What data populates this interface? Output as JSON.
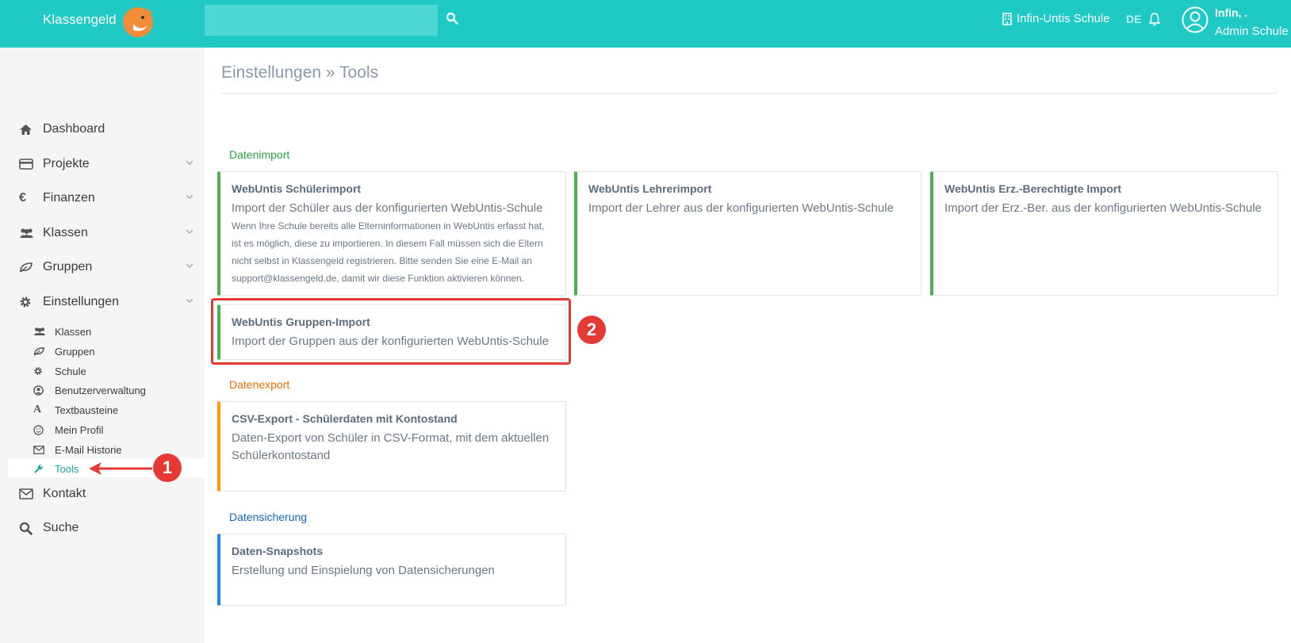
{
  "header": {
    "logo_text": "Klassengeld",
    "search_placeholder": "",
    "school_name": "Infin-Untis Schule",
    "language": "DE",
    "user_name": "Infin, .",
    "user_role": "Admin Schule"
  },
  "sidebar": {
    "items": [
      {
        "label": "Dashboard",
        "icon": "home-icon"
      },
      {
        "label": "Projekte",
        "icon": "card-icon"
      },
      {
        "label": "Finanzen",
        "icon": "euro-icon"
      },
      {
        "label": "Klassen",
        "icon": "users-icon"
      },
      {
        "label": "Gruppen",
        "icon": "leaf-icon"
      },
      {
        "label": "Einstellungen",
        "icon": "gear-icon"
      }
    ],
    "sub_items": [
      {
        "label": "Klassen",
        "icon": "users-icon"
      },
      {
        "label": "Gruppen",
        "icon": "leaf-icon"
      },
      {
        "label": "Schule",
        "icon": "gear-icon"
      },
      {
        "label": "Benutzerverwaltung",
        "icon": "user-circle-icon"
      },
      {
        "label": "Textbausteine",
        "icon": "font-icon"
      },
      {
        "label": "Mein Profil",
        "icon": "smile-icon"
      },
      {
        "label": "E-Mail Historie",
        "icon": "envelope-icon"
      },
      {
        "label": "Tools",
        "icon": "wrench-icon",
        "active": true
      }
    ],
    "bottom_items": [
      {
        "label": "Kontakt",
        "icon": "envelope-icon"
      },
      {
        "label": "Suche",
        "icon": "search-icon"
      }
    ]
  },
  "main": {
    "breadcrumb": "Einstellungen » Tools",
    "sections": {
      "import": {
        "title": "Datenimport",
        "color": "#2e9e3e",
        "cards": [
          {
            "title": "WebUntis Schülerimport",
            "desc": "Import der Schüler aus der konfigurierten WebUntis-Schule",
            "note": "Wenn Ihre Schule bereits alle Elterninformationen in WebUntis erfasst hat, ist es möglich, diese zu importieren. In diesem Fall müssen sich die Eltern nicht selbst in Klassengeld registrieren. Bitte senden Sie eine E-Mail an support@klassengeld.de, damit wir diese Funktion aktivieren können."
          },
          {
            "title": "WebUntis Lehrerimport",
            "desc": "Import der Lehrer aus der konfigurierten WebUntis-Schule"
          },
          {
            "title": "WebUntis Erz.-Berechtigte Import",
            "desc": "Import der Erz.-Ber. aus der konfigurierten WebUntis-Schule"
          },
          {
            "title": "WebUntis Gruppen-Import",
            "desc": "Import der Gruppen aus der konfigurierten WebUntis-Schule"
          }
        ]
      },
      "export": {
        "title": "Datenexport",
        "color": "#ef6c00",
        "cards": [
          {
            "title": "CSV-Export - Schülerdaten mit Kontostand",
            "desc": "Daten-Export von Schüler in CSV-Format, mit dem aktuellen Schülerkontostand"
          }
        ]
      },
      "backup": {
        "title": "Datensicherung",
        "color": "#1565c0",
        "cards": [
          {
            "title": "Daten-Snapshots",
            "desc": "Erstellung und Einspielung von Datensicherungen"
          }
        ]
      }
    }
  },
  "annotations": {
    "marker_1": "1",
    "marker_2": "2"
  }
}
